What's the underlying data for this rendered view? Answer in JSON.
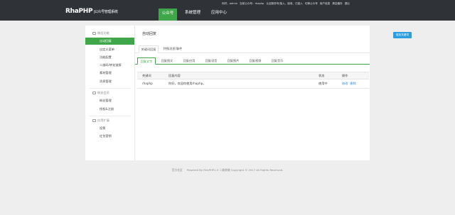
{
  "app": {
    "logo_main": "RhaPHP",
    "logo_sub": "|公众号管理系统"
  },
  "nav": [
    {
      "label": "公众号",
      "active": true
    },
    {
      "label": "系统管理",
      "active": false
    },
    {
      "label": "应用中心",
      "active": false
    }
  ],
  "topinfo": {
    "greeting": "你好，admin",
    "current_account": "当前公众号：rhaphp",
    "account_detail": "认证服务号/接入、接收、已接入",
    "switch_account": "切换公众号",
    "user_center": "用户信息",
    "clear_cache": "清空缓存",
    "logout": "退出"
  },
  "sidebar": {
    "groups": [
      {
        "title": "微信功能",
        "icon": "chat-icon",
        "items": [
          {
            "label": "自动回复",
            "active": true
          },
          {
            "label": "自定义菜单",
            "active": false
          },
          {
            "label": "功能配置",
            "active": false
          },
          {
            "label": "二维码/转化链接",
            "active": false
          },
          {
            "label": "素材管理",
            "active": false
          },
          {
            "label": "消息管理",
            "active": false
          }
        ]
      },
      {
        "title": "粉丝会员",
        "icon": "user-icon",
        "items": [
          {
            "label": "粉丝管理",
            "active": false
          },
          {
            "label": "授权&注册",
            "active": false
          }
        ]
      },
      {
        "title": "应用扩展",
        "icon": "app-icon",
        "items": [
          {
            "label": "投票",
            "active": false
          },
          {
            "label": "红包营销",
            "active": false
          }
        ]
      }
    ]
  },
  "content": {
    "title": "自动回复",
    "add_button": "增加关键词",
    "tabs_primary": [
      {
        "label": "关键词回复",
        "active": true
      },
      {
        "label": "特殊消息/事件",
        "active": false
      }
    ],
    "tabs_secondary": [
      {
        "label": "回复文字",
        "active": true
      },
      {
        "label": "回复图文",
        "active": false
      },
      {
        "label": "回复应用",
        "active": false
      },
      {
        "label": "回复语音",
        "active": false
      },
      {
        "label": "回复图片",
        "active": false
      },
      {
        "label": "回复视频",
        "active": false
      },
      {
        "label": "回复音乐",
        "active": false
      }
    ],
    "table": {
      "headers": [
        "关键词",
        "回复内容",
        "状态",
        "操作"
      ],
      "rows": [
        {
          "keyword": "rhaphp",
          "reply": "你好，欢迎你使用rhaphp。",
          "status": "使用中",
          "edit": "修改",
          "delete": "删除"
        }
      ]
    }
  },
  "footer": {
    "link": "官方社区",
    "text": "Powered By RhaPHP1.0 二维商城 Copyright © 2017 All Rights Reserved."
  }
}
